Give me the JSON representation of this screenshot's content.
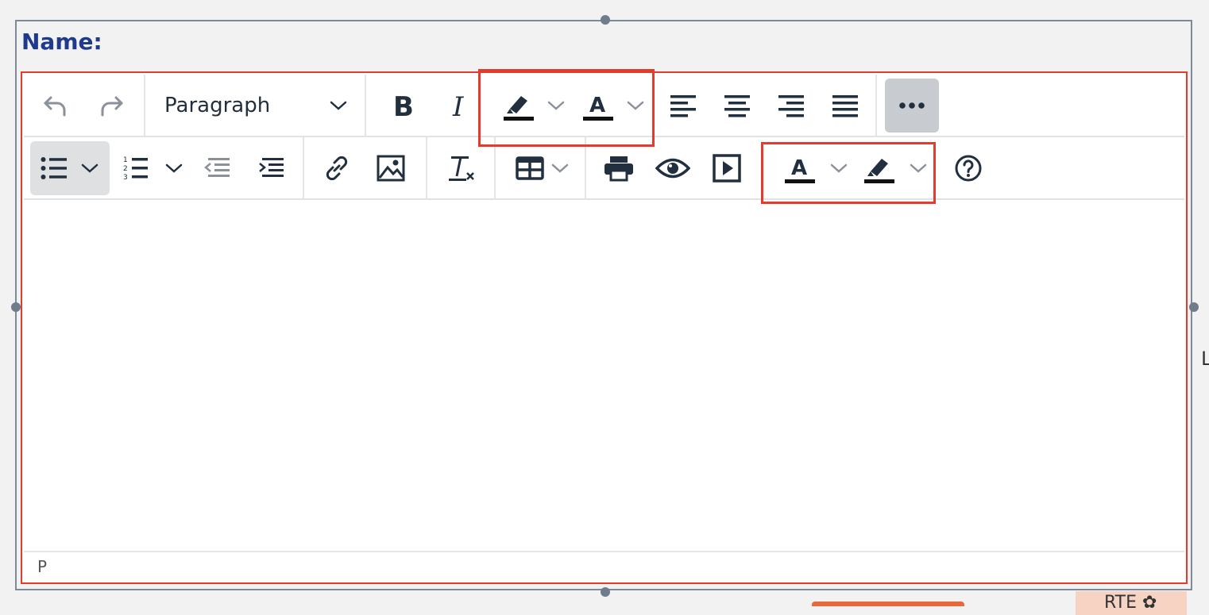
{
  "field": {
    "label": "Name:"
  },
  "toolbar": {
    "block_format": "Paragraph",
    "row1": [
      "undo-icon",
      "redo-icon",
      "bold-icon",
      "italic-icon",
      "highlight-color-icon",
      "text-color-icon",
      "align-left-icon",
      "align-center-icon",
      "align-right-icon",
      "align-justify-icon",
      "more-icon"
    ],
    "row2": [
      "bullet-list-icon",
      "numbered-list-icon",
      "outdent-icon",
      "indent-icon",
      "link-icon",
      "image-icon",
      "clear-format-icon",
      "table-icon",
      "print-icon",
      "preview-icon",
      "media-icon",
      "text-color-icon",
      "highlight-color-icon",
      "help-icon"
    ]
  },
  "statusbar": {
    "path": "P"
  },
  "side": {
    "letter": "L",
    "bottom_tag": "RTE ✿"
  },
  "colors": {
    "accent_red": "#e53b2c",
    "icon": "#222f3e",
    "label_blue": "#1f3a8a"
  }
}
